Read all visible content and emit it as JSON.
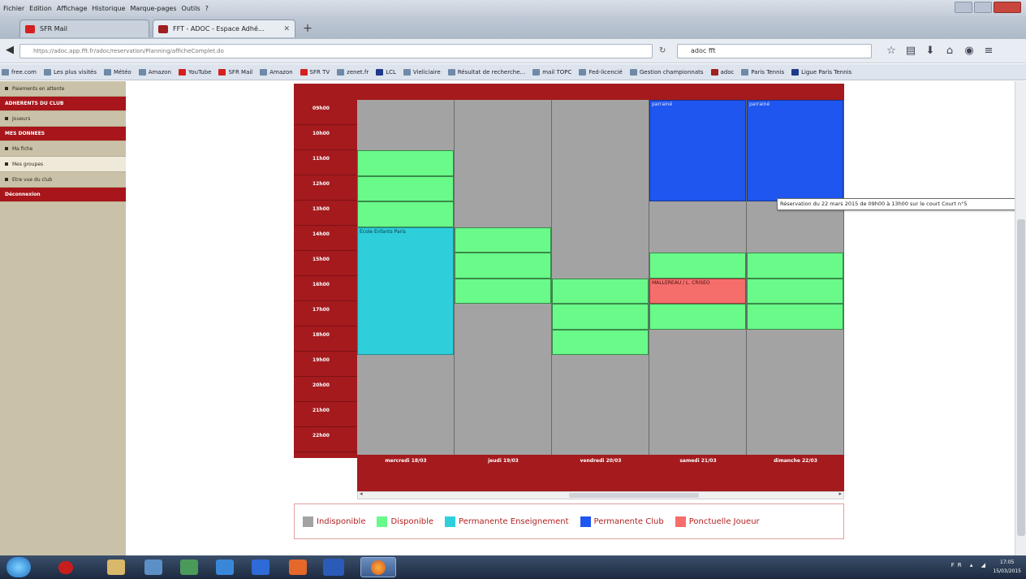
{
  "menubar": [
    "Fichier",
    "Edition",
    "Affichage",
    "Historique",
    "Marque-pages",
    "Outils",
    "?"
  ],
  "tabs": [
    {
      "label": "SFR Mail",
      "icon": "sfr-icon"
    },
    {
      "label": "FFT - ADOC - Espace Adhé...",
      "icon": "fft-icon"
    }
  ],
  "nav": {
    "url": "https://adoc.app.fft.fr/adoc/reservation/Planning/afficheComplet.do",
    "search": "adoc fft"
  },
  "bookmarks": [
    "free.com",
    "Les plus visités",
    "Météo",
    "Amazon",
    "YouTube",
    "SFR Mail",
    "Amazon",
    "SFR TV",
    "zenet.fr",
    "LCL",
    "Vieliciaire",
    "Résultat de recherche...",
    "mail TOPC",
    "Fed-licencié",
    "Gestion championnats",
    "adoc",
    "Paris Tennis",
    "Ligue Paris Tennis"
  ],
  "sidebar": [
    {
      "label": "Paiements en attente",
      "type": "item"
    },
    {
      "label": "ADHERENTS DU CLUB",
      "type": "head"
    },
    {
      "label": "Joueurs",
      "type": "item"
    },
    {
      "label": "MES DONNEES",
      "type": "head"
    },
    {
      "label": "Ma fiche",
      "type": "item"
    },
    {
      "label": "Mes groupes",
      "type": "item-light"
    },
    {
      "label": "Etre vue du club",
      "type": "item"
    },
    {
      "label": "Déconnexion",
      "type": "head"
    }
  ],
  "times": [
    "09h00",
    "10h00",
    "11h00",
    "12h00",
    "13h00",
    "14h00",
    "15h00",
    "16h00",
    "17h00",
    "18h00",
    "19h00",
    "20h00",
    "21h00",
    "22h00"
  ],
  "days": [
    "mercredi 18/03",
    "jeudi 19/03",
    "vendredi 20/03",
    "samedi 21/03",
    "dimanche 22/03"
  ],
  "slots": {
    "d0_c": "Ecole Enfants Paris",
    "d3_b": "parrainé",
    "d4_b": "parrainé",
    "d3_r": "MALLEREAU / L. CRISEO"
  },
  "tooltip": "Réservation du 22 mars 2015 de 09h00 à 13h00 sur le court Court n°5",
  "legend": [
    {
      "label": "Indisponible",
      "color": "#a3a3a3"
    },
    {
      "label": "Disponible",
      "color": "#69fa8a"
    },
    {
      "label": "Permanente Enseignement",
      "color": "#2ecfdb"
    },
    {
      "label": "Permanente Club",
      "color": "#1f56f0"
    },
    {
      "label": "Ponctuelle Joueur",
      "color": "#f56e6c"
    }
  ],
  "clock": {
    "time": "17:05",
    "date": "15/03/2015"
  },
  "tray": "FR"
}
